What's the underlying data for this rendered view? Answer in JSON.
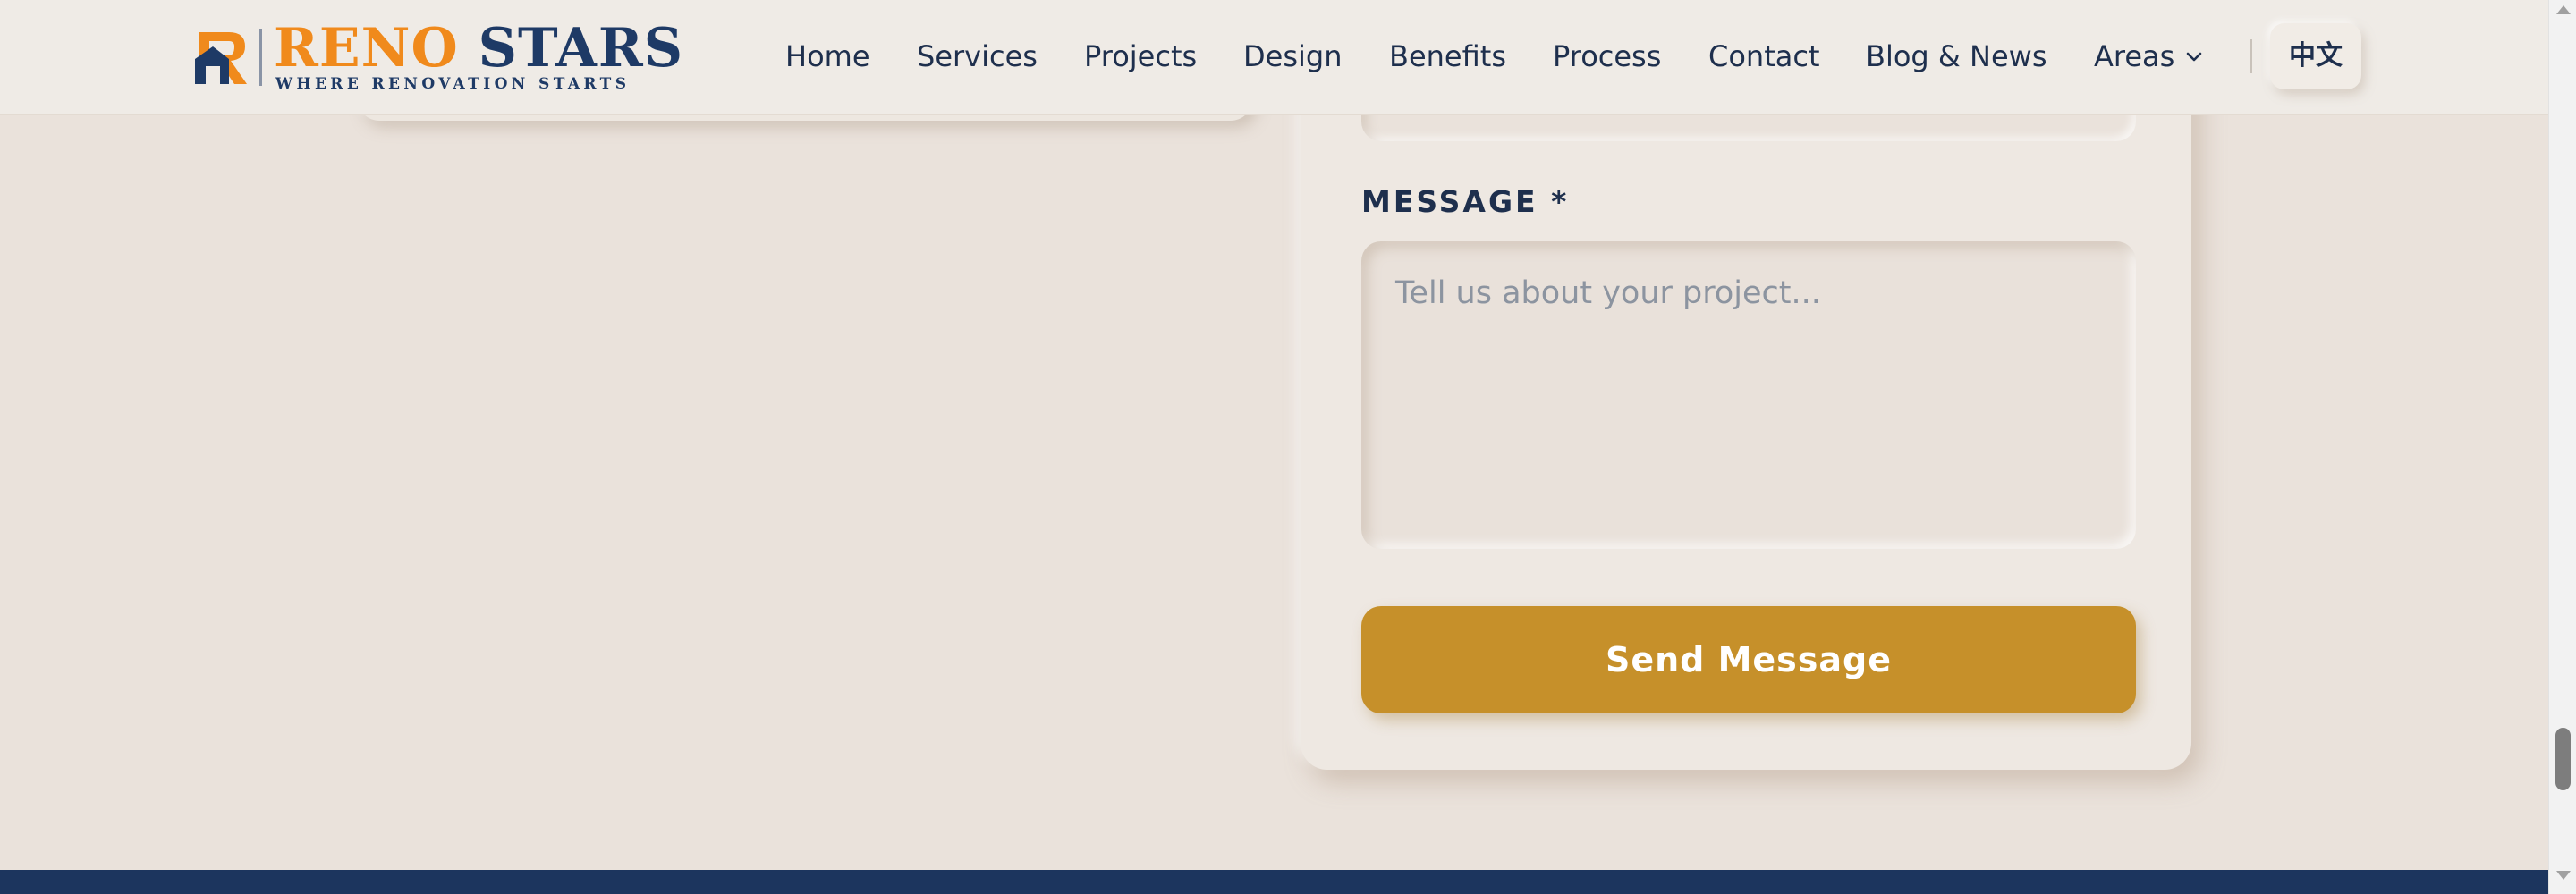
{
  "header": {
    "logo": {
      "title_part1": "RENO",
      "title_part2": "STARS",
      "tagline": "WHERE RENOVATION STARTS"
    },
    "nav": [
      {
        "label": "Home"
      },
      {
        "label": "Services"
      },
      {
        "label": "Projects"
      },
      {
        "label": "Design"
      },
      {
        "label": "Benefits"
      },
      {
        "label": "Process"
      },
      {
        "label": "Contact"
      },
      {
        "label": "Blog & News"
      },
      {
        "label": "Areas"
      }
    ],
    "areas_icon": "chevron-down-icon",
    "language_button": "中文"
  },
  "form": {
    "message_label": "MESSAGE *",
    "message_placeholder": "Tell us about your project...",
    "message_value": "",
    "submit_label": "Send Message"
  },
  "colors": {
    "page_background": "#EAE2DB",
    "header_background": "#EFEBE6",
    "brand_orange": "#F08A1C",
    "brand_navy": "#1E3A66",
    "text_dark": "#1E2F4D",
    "accent_gold": "#C6902A",
    "footer_navy": "#1C355E"
  }
}
